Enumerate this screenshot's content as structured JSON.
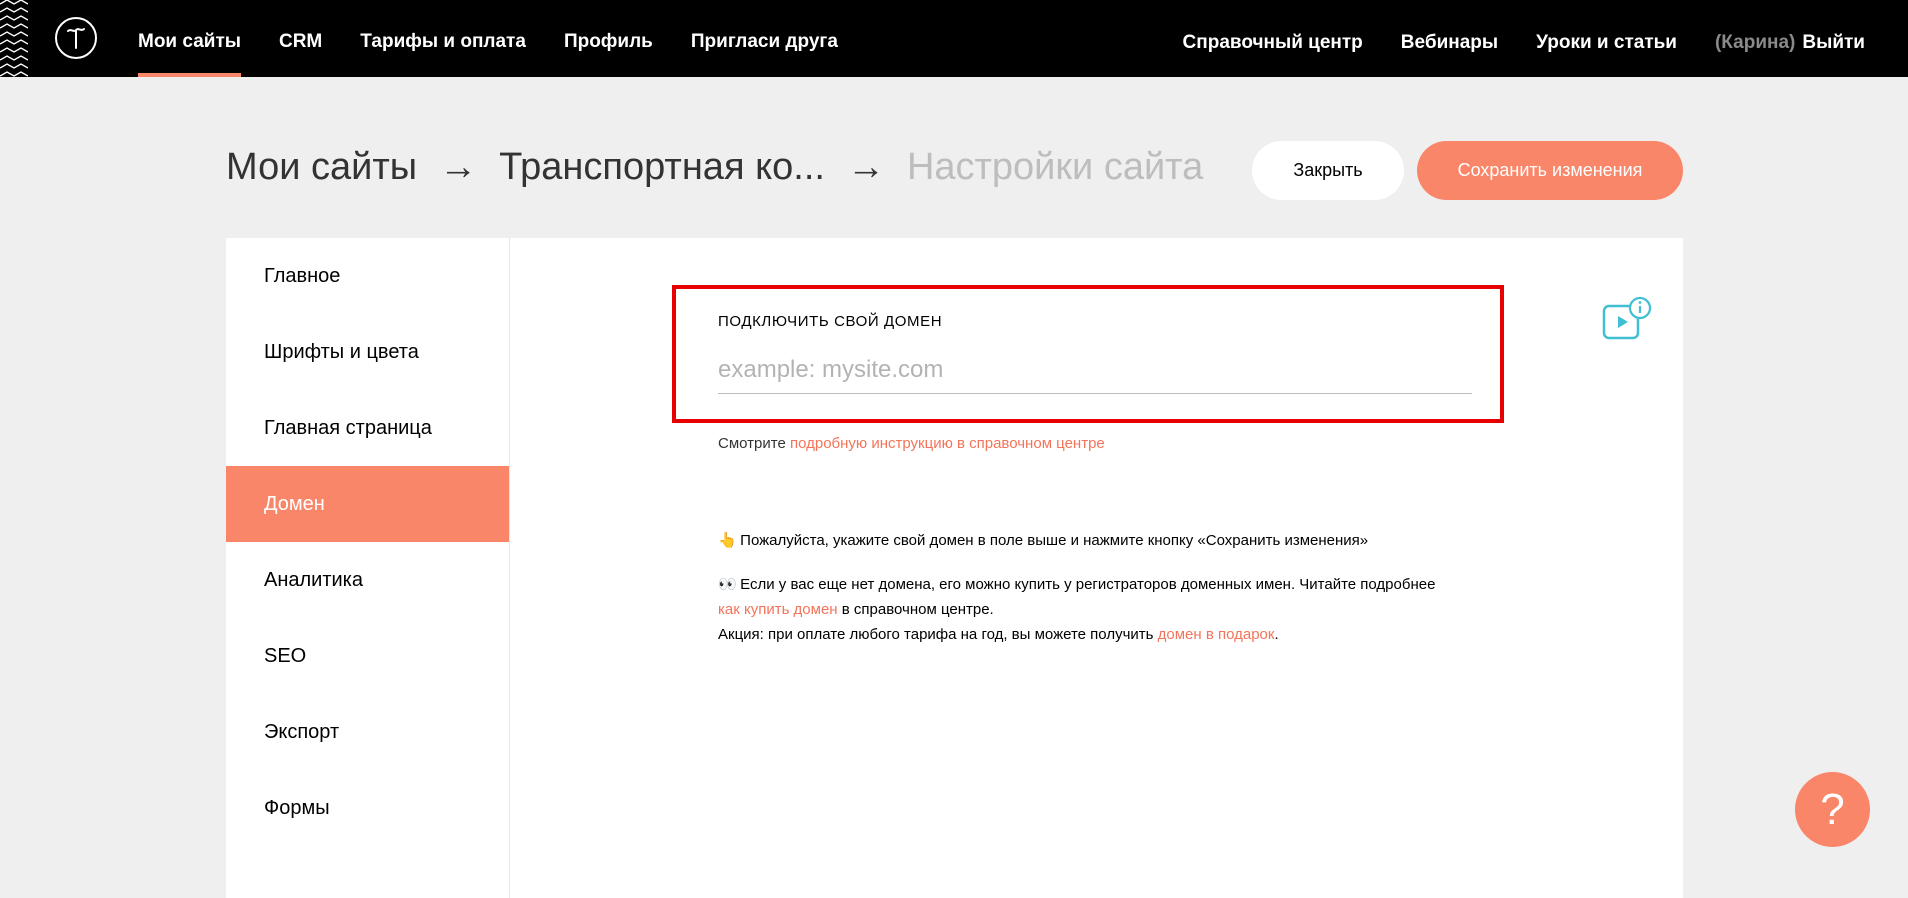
{
  "topbar": {
    "logo_icon": "tilda-logo-icon",
    "nav_left": [
      "Мои сайты",
      "CRM",
      "Тарифы и оплата",
      "Профиль",
      "Пригласи друга"
    ],
    "nav_right": [
      "Справочный центр",
      "Вебинары",
      "Уроки и статьи"
    ],
    "user_name": "(Карина)",
    "logout_label": "Выйти"
  },
  "breadcrumb": {
    "items": [
      "Мои сайты",
      "Транспортная ко...",
      "Настройки сайта"
    ],
    "separator": "→"
  },
  "actions": {
    "close_label": "Закрыть",
    "save_label": "Сохранить изменения"
  },
  "sidebar": {
    "items": [
      "Главное",
      "Шрифты и цвета",
      "Главная страница",
      "Домен",
      "Аналитика",
      "SEO",
      "Экспорт",
      "Формы"
    ],
    "active_index": 3
  },
  "domain": {
    "label": "ПОДКЛЮЧИТЬ СВОЙ ДОМЕН",
    "placeholder": "example: mysite.com",
    "hint_prefix": "Смотрите ",
    "hint_link": "подробную инструкцию в справочном центре"
  },
  "notes": {
    "line1_emoji": "👆",
    "line1": "Пожалуйста, укажите свой домен в поле выше и нажмите кнопку «Сохранить изменения»",
    "line2_emoji": "👀",
    "line2": "Если у вас еще нет домена, его можно купить у регистраторов доменных имен. Читайте подробнее",
    "line2_link": "как купить домен",
    "line2_suffix": " в справочном центре.",
    "line3": "Акция: при оплате любого тарифа на год, вы можете получить ",
    "line3_link": "домен в подарок",
    "line3_suffix": "."
  },
  "help_fab": "?",
  "colors": {
    "accent": "#fa8669",
    "highlight": "#e80000",
    "link": "#f4745a",
    "topbar": "#000000"
  }
}
